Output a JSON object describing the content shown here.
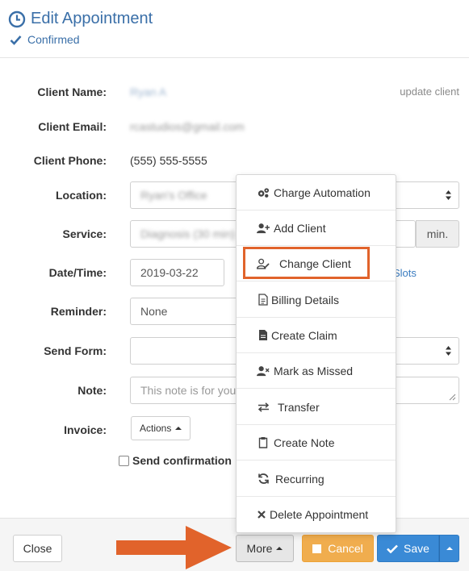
{
  "header": {
    "title": "Edit Appointment",
    "status": "Confirmed"
  },
  "form": {
    "client_name_label": "Client Name:",
    "client_name_value": "Ryan A",
    "update_client": "update client",
    "client_email_label": "Client Email:",
    "client_email_value": "rcastudios@gmail.com",
    "client_phone_label": "Client Phone:",
    "client_phone_value": "(555) 555-5555",
    "location_label": "Location:",
    "location_value": "Ryan's Office",
    "service_label": "Service:",
    "service_value": "Diagnosis (30 min)",
    "service_unit": "min.",
    "datetime_label": "Date/Time:",
    "date_value": "2019-03-22",
    "slots_link": "Slots",
    "reminder_label": "Reminder:",
    "reminder_value": "None",
    "send_form_label": "Send Form:",
    "send_form_value": "",
    "note_label": "Note:",
    "note_placeholder": "This note is for you",
    "invoice_label": "Invoice:",
    "actions_button": "Actions",
    "send_confirmation_label": "Send confirmation"
  },
  "more_menu": {
    "items": [
      {
        "label": "Charge Automation",
        "icon": "cogs-icon"
      },
      {
        "label": "Add Client",
        "icon": "user-plus-icon"
      },
      {
        "label": "Change Client",
        "icon": "user-edit-icon"
      },
      {
        "label": "Billing Details",
        "icon": "invoice-icon"
      },
      {
        "label": "Create Claim",
        "icon": "file-icon"
      },
      {
        "label": "Mark as Missed",
        "icon": "user-times-icon"
      },
      {
        "label": "Transfer",
        "icon": "exchange-icon"
      },
      {
        "label": "Create Note",
        "icon": "clipboard-icon"
      },
      {
        "label": "Recurring",
        "icon": "refresh-icon"
      },
      {
        "label": "Delete Appointment",
        "icon": "times-icon"
      }
    ]
  },
  "footer": {
    "close": "Close",
    "more": "More",
    "cancel": "Cancel",
    "save": "Save"
  },
  "colors": {
    "accent": "#3a6fa8",
    "cancel": "#f0ad4e",
    "save": "#3a8ad6",
    "annotation": "#e1632b"
  }
}
